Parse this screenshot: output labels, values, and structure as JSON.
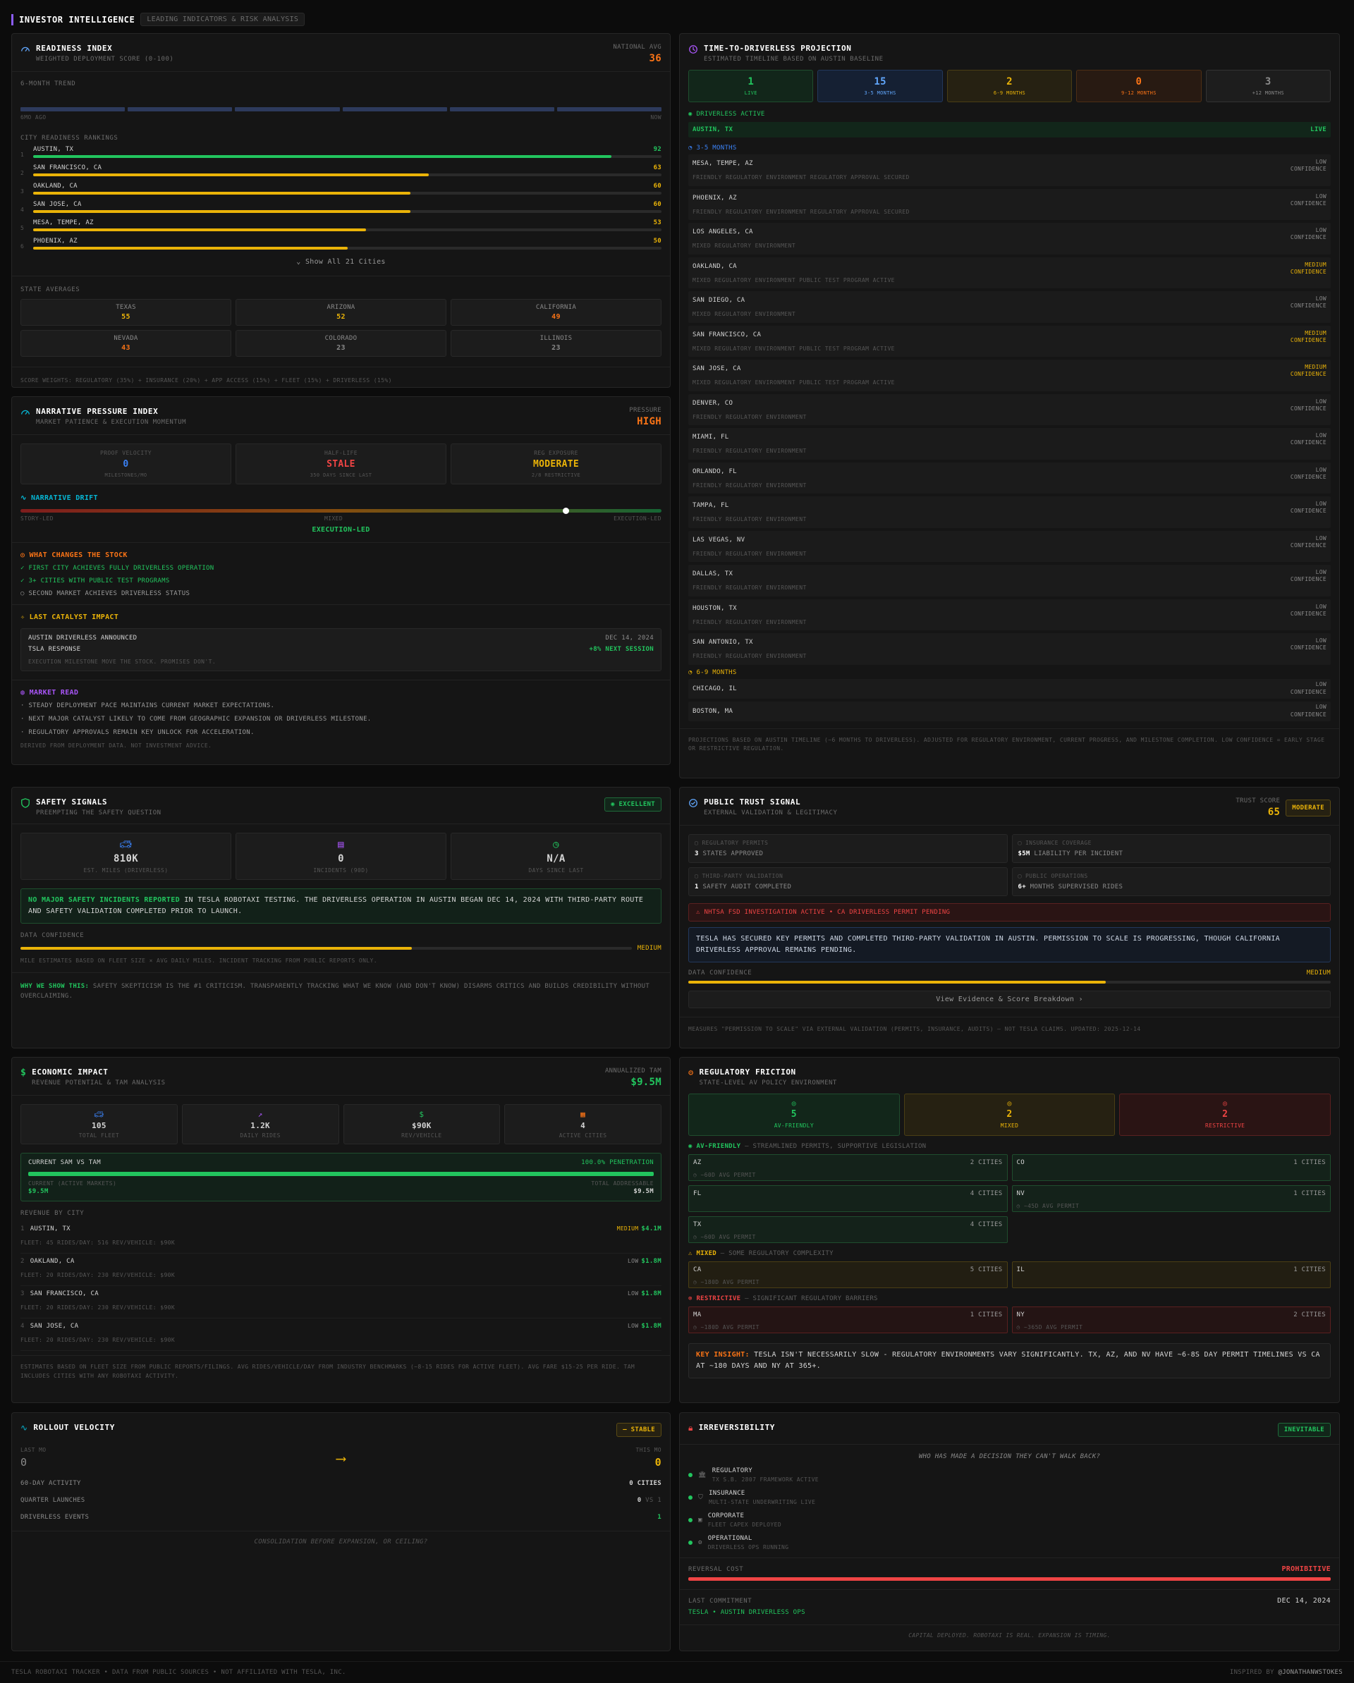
{
  "header": {
    "title": "INVESTOR INTELLIGENCE",
    "tag": "LEADING INDICATORS & RISK ANALYSIS"
  },
  "readiness": {
    "title": "READINESS INDEX",
    "subtitle": "WEIGHTED DEPLOYMENT SCORE (0-100)",
    "avg_label": "NATIONAL AVG",
    "avg_value": "36",
    "trend_label": "6-MONTH TREND",
    "trend_start": "6MO AGO",
    "trend_end": "NOW",
    "rank_label": "CITY READINESS RANKINGS",
    "cities": [
      {
        "rank": "1",
        "name": "AUSTIN, TX",
        "score": "92",
        "pct": 0.92,
        "color": "#22c55e"
      },
      {
        "rank": "2",
        "name": "SAN FRANCISCO, CA",
        "score": "63",
        "pct": 0.63,
        "color": "#eab308"
      },
      {
        "rank": "3",
        "name": "OAKLAND, CA",
        "score": "60",
        "pct": 0.6,
        "color": "#eab308"
      },
      {
        "rank": "4",
        "name": "SAN JOSE, CA",
        "score": "60",
        "pct": 0.6,
        "color": "#eab308"
      },
      {
        "rank": "5",
        "name": "MESA, TEMPE, AZ",
        "score": "53",
        "pct": 0.53,
        "color": "#eab308"
      },
      {
        "rank": "6",
        "name": "PHOENIX, AZ",
        "score": "50",
        "pct": 0.5,
        "color": "#eab308"
      }
    ],
    "show_all": "Show All 21 Cities",
    "state_label": "STATE AVERAGES",
    "states": [
      {
        "name": "TEXAS",
        "value": "55",
        "color": "#eab308"
      },
      {
        "name": "ARIZONA",
        "value": "52",
        "color": "#eab308"
      },
      {
        "name": "CALIFORNIA",
        "value": "49",
        "color": "#f97316"
      },
      {
        "name": "NEVADA",
        "value": "43",
        "color": "#f97316"
      },
      {
        "name": "COLORADO",
        "value": "23",
        "color": "#8a8a8a"
      },
      {
        "name": "ILLINOIS",
        "value": "23",
        "color": "#8a8a8a"
      }
    ],
    "footer": "SCORE WEIGHTS: REGULATORY (35%) + INSURANCE (20%) + APP ACCESS (15%) + FLEET (15%) + DRIVERLESS (15%)"
  },
  "narrative": {
    "title": "NARRATIVE PRESSURE INDEX",
    "subtitle": "MARKET PATIENCE & EXECUTION MOMENTUM",
    "pressure_label": "PRESSURE",
    "pressure_value": "HIGH",
    "metrics": [
      {
        "label": "PROOF VELOCITY",
        "value": "0",
        "sub": "MILESTONES/MO",
        "color": "#3b82f6"
      },
      {
        "label": "HALF-LIFE",
        "value": "STALE",
        "sub": "350 DAYS SINCE LAST",
        "color": "#ef4444"
      },
      {
        "label": "REG EXPOSURE",
        "value": "MODERATE",
        "sub": "2/8 RESTRICTIVE",
        "color": "#eab308"
      }
    ],
    "drift_label": "NARRATIVE DRIFT",
    "drift_left": "STORY-LED",
    "drift_mid": "MIXED",
    "drift_right": "EXECUTION-LED",
    "drift_value": "EXECUTION-LED",
    "drift_pos": 0.85,
    "changes_label": "WHAT CHANGES THE STOCK",
    "changes": [
      {
        "mark": "✓",
        "text": "FIRST CITY ACHIEVES FULLY DRIVERLESS OPERATION",
        "color": "#22c55e"
      },
      {
        "mark": "✓",
        "text": "3+ CITIES WITH PUBLIC TEST PROGRAMS",
        "color": "#22c55e"
      },
      {
        "mark": "○",
        "text": "SECOND MARKET ACHIEVES DRIVERLESS STATUS",
        "color": "#9a9a9a"
      }
    ],
    "catalyst_label": "LAST CATALYST IMPACT",
    "catalyst_event": "AUSTIN DRIVERLESS ANNOUNCED",
    "catalyst_date": "DEC 14, 2024",
    "catalyst_resp_label": "TSLA RESPONSE",
    "catalyst_resp": "+8% NEXT SESSION",
    "catalyst_note": "EXECUTION MILESTONE MOVE THE STOCK. PROMISES DON'T.",
    "read_label": "MARKET READ",
    "reads": [
      "STEADY DEPLOYMENT PACE MAINTAINS CURRENT MARKET EXPECTATIONS.",
      "NEXT MAJOR CATALYST LIKELY TO COME FROM GEOGRAPHIC EXPANSION OR DRIVERLESS MILESTONE.",
      "REGULATORY APPROVALS REMAIN KEY UNLOCK FOR ACCELERATION."
    ],
    "footer": "DERIVED FROM DEPLOYMENT DATA. NOT INVESTMENT ADVICE."
  },
  "projection": {
    "title": "TIME-TO-DRIVERLESS PROJECTION",
    "subtitle": "ESTIMATED TIMELINE BASED ON AUSTIN BASELINE",
    "buckets": [
      {
        "value": "1",
        "label": "LIVE",
        "color": "#22c55e",
        "bg": "#12261a",
        "bd": "#1f4d2e"
      },
      {
        "value": "15",
        "label": "3-5 MONTHS",
        "color": "#60a5fa",
        "bg": "#152033",
        "bd": "#22385c"
      },
      {
        "value": "2",
        "label": "6-9 MONTHS",
        "color": "#eab308",
        "bg": "#262112",
        "bd": "#4a3e14"
      },
      {
        "value": "0",
        "label": "9-12 MONTHS",
        "color": "#f97316",
        "bg": "#281a12",
        "bd": "#4d2e14"
      },
      {
        "value": "3",
        "label": "+12 MONTHS",
        "color": "#8a8a8a",
        "bg": "#1d1d1d",
        "bd": "#333"
      }
    ],
    "live_label": "DRIVERLESS ACTIVE",
    "live_city": "AUSTIN, TX",
    "live_tag": "LIVE",
    "g35_label": "3-5 MONTHS",
    "g35": [
      {
        "city": "MESA, TEMPE, AZ",
        "note": "FRIENDLY REGULATORY ENVIRONMENT REGULATORY APPROVAL SECURED",
        "c1": "LOW",
        "c2": "CONFIDENCE",
        "cc": "#8a8a8a"
      },
      {
        "city": "PHOENIX, AZ",
        "note": "FRIENDLY REGULATORY ENVIRONMENT REGULATORY APPROVAL SECURED",
        "c1": "LOW",
        "c2": "CONFIDENCE",
        "cc": "#8a8a8a"
      },
      {
        "city": "LOS ANGELES, CA",
        "note": "MIXED REGULATORY ENVIRONMENT",
        "c1": "LOW",
        "c2": "CONFIDENCE",
        "cc": "#8a8a8a"
      },
      {
        "city": "OAKLAND, CA",
        "note": "MIXED REGULATORY ENVIRONMENT PUBLIC TEST PROGRAM ACTIVE",
        "c1": "MEDIUM",
        "c2": "CONFIDENCE",
        "cc": "#eab308"
      },
      {
        "city": "SAN DIEGO, CA",
        "note": "MIXED REGULATORY ENVIRONMENT",
        "c1": "LOW",
        "c2": "CONFIDENCE",
        "cc": "#8a8a8a"
      },
      {
        "city": "SAN FRANCISCO, CA",
        "note": "MIXED REGULATORY ENVIRONMENT PUBLIC TEST PROGRAM ACTIVE",
        "c1": "MEDIUM",
        "c2": "CONFIDENCE",
        "cc": "#eab308"
      },
      {
        "city": "SAN JOSE, CA",
        "note": "MIXED REGULATORY ENVIRONMENT PUBLIC TEST PROGRAM ACTIVE",
        "c1": "MEDIUM",
        "c2": "CONFIDENCE",
        "cc": "#eab308"
      },
      {
        "city": "DENVER, CO",
        "note": "FRIENDLY REGULATORY ENVIRONMENT",
        "c1": "LOW",
        "c2": "CONFIDENCE",
        "cc": "#8a8a8a"
      },
      {
        "city": "MIAMI, FL",
        "note": "FRIENDLY REGULATORY ENVIRONMENT",
        "c1": "LOW",
        "c2": "CONFIDENCE",
        "cc": "#8a8a8a"
      },
      {
        "city": "ORLANDO, FL",
        "note": "FRIENDLY REGULATORY ENVIRONMENT",
        "c1": "LOW",
        "c2": "CONFIDENCE",
        "cc": "#8a8a8a"
      },
      {
        "city": "TAMPA, FL",
        "note": "FRIENDLY REGULATORY ENVIRONMENT",
        "c1": "LOW",
        "c2": "CONFIDENCE",
        "cc": "#8a8a8a"
      },
      {
        "city": "LAS VEGAS, NV",
        "note": "FRIENDLY REGULATORY ENVIRONMENT",
        "c1": "LOW",
        "c2": "CONFIDENCE",
        "cc": "#8a8a8a"
      },
      {
        "city": "DALLAS, TX",
        "note": "FRIENDLY REGULATORY ENVIRONMENT",
        "c1": "LOW",
        "c2": "CONFIDENCE",
        "cc": "#8a8a8a"
      },
      {
        "city": "HOUSTON, TX",
        "note": "FRIENDLY REGULATORY ENVIRONMENT",
        "c1": "LOW",
        "c2": "CONFIDENCE",
        "cc": "#8a8a8a"
      },
      {
        "city": "SAN ANTONIO, TX",
        "note": "FRIENDLY REGULATORY ENVIRONMENT",
        "c1": "LOW",
        "c2": "CONFIDENCE",
        "cc": "#8a8a8a"
      }
    ],
    "g69_label": "6-9 MONTHS",
    "g69": [
      {
        "city": "CHICAGO, IL",
        "c1": "LOW",
        "c2": "CONFIDENCE"
      },
      {
        "city": "BOSTON, MA",
        "c1": "LOW",
        "c2": "CONFIDENCE"
      }
    ],
    "footer": "PROJECTIONS BASED ON AUSTIN TIMELINE (~6 MONTHS TO DRIVERLESS). ADJUSTED FOR REGULATORY ENVIRONMENT, CURRENT PROGRESS, AND MILESTONE COMPLETION. LOW CONFIDENCE = EARLY STAGE OR RESTRICTIVE REGULATION."
  },
  "safety": {
    "title": "SAFETY SIGNALS",
    "subtitle": "PREEMPTING THE SAFETY QUESTION",
    "badge": "EXCELLENT",
    "stats": [
      {
        "value": "810K",
        "label": "EST. MILES (DRIVERLESS)",
        "icon": "car-icon",
        "color": "#3b82f6"
      },
      {
        "value": "0",
        "label": "INCIDENTS (90D)",
        "icon": "report-icon",
        "color": "#a855f7"
      },
      {
        "value": "N/A",
        "label": "DAYS SINCE LAST",
        "icon": "clock-icon",
        "color": "#22c55e"
      }
    ],
    "note_hl": "NO MAJOR SAFETY INCIDENTS REPORTED",
    "note": " IN TESLA ROBOTAXI TESTING. THE DRIVERLESS OPERATION IN AUSTIN BEGAN DEC 14, 2024 WITH THIRD-PARTY ROUTE AND SAFETY VALIDATION COMPLETED PRIOR TO LAUNCH.",
    "conf_label": "DATA CONFIDENCE",
    "conf_value": "MEDIUM",
    "conf_pct": 0.64,
    "conf_note": "MILE ESTIMATES BASED ON FLEET SIZE × AVG DAILY MILES. INCIDENT TRACKING FROM PUBLIC REPORTS ONLY.",
    "why_label": "WHY WE SHOW THIS:",
    "why": " SAFETY SKEPTICISM IS THE #1 CRITICISM. TRANSPARENTLY TRACKING WHAT WE KNOW (AND DON'T KNOW) DISARMS CRITICS AND BUILDS CREDIBILITY WITHOUT OVERCLAIMING."
  },
  "trust": {
    "title": "PUBLIC TRUST SIGNAL",
    "subtitle": "EXTERNAL VALIDATION & LEGITIMACY",
    "score_label": "TRUST SCORE",
    "score": "65",
    "badge": "MODERATE",
    "items": [
      {
        "label": "REGULATORY PERMITS",
        "num": "3",
        "text": "STATES APPROVED"
      },
      {
        "label": "INSURANCE COVERAGE",
        "num": "$5M",
        "text": "LIABILITY PER INCIDENT"
      },
      {
        "label": "THIRD-PARTY VALIDATION",
        "num": "1",
        "text": "SAFETY AUDIT COMPLETED"
      },
      {
        "label": "PUBLIC OPERATIONS",
        "num": "6+",
        "text": "MONTHS SUPERVISED RIDES"
      }
    ],
    "alert": "NHTSA FSD INVESTIGATION ACTIVE • CA DRIVERLESS PERMIT PENDING",
    "summary": "TESLA HAS SECURED KEY PERMITS AND COMPLETED THIRD-PARTY VALIDATION IN AUSTIN. PERMISSION TO SCALE IS PROGRESSING, THOUGH CALIFORNIA DRIVERLESS APPROVAL REMAINS PENDING.",
    "conf_label": "DATA CONFIDENCE",
    "conf_value": "MEDIUM",
    "conf_pct": 0.65,
    "button": "View Evidence & Score Breakdown ›",
    "footer": "MEASURES \"PERMISSION TO SCALE\" VIA EXTERNAL VALIDATION (PERMITS, INSURANCE, AUDITS) — NOT TESLA CLAIMS. UPDATED: 2025-12-14"
  },
  "economic": {
    "title": "ECONOMIC IMPACT",
    "subtitle": "REVENUE POTENTIAL & TAM ANALYSIS",
    "tam_label": "ANNUALIZED TAM",
    "tam_value": "$9.5M",
    "stats": [
      {
        "value": "105",
        "label": "TOTAL FLEET",
        "icon": "car-icon",
        "color": "#3b82f6"
      },
      {
        "value": "1.2K",
        "label": "DAILY RIDES",
        "icon": "trend-icon",
        "color": "#a855f7"
      },
      {
        "value": "$90K",
        "label": "REV/VEHICLE",
        "icon": "dollar-icon",
        "color": "#22c55e"
      },
      {
        "value": "4",
        "label": "ACTIVE CITIES",
        "icon": "building-icon",
        "color": "#f97316"
      }
    ],
    "sam_label": "CURRENT SAM VS TAM",
    "sam_pen": "100.0% PENETRATION",
    "sam_l1": "CURRENT (ACTIVE MARKETS)",
    "sam_l2": "$9.5M",
    "sam_r1": "TOTAL ADDRESSABLE",
    "sam_r2": "$9.5M",
    "sam_pct": 1.0,
    "rev_label": "REVENUE BY CITY",
    "revs": [
      {
        "rank": "1",
        "city": "AUSTIN, TX",
        "conf": "MEDIUM",
        "cc": "#eab308",
        "amount": "$4.1M",
        "detail": "FLEET: 45  RIDES/DAY: 516  REV/VEHICLE: $90K"
      },
      {
        "rank": "2",
        "city": "OAKLAND, CA",
        "conf": "LOW",
        "cc": "#8a8a8a",
        "amount": "$1.8M",
        "detail": "FLEET: 20  RIDES/DAY: 230  REV/VEHICLE: $90K"
      },
      {
        "rank": "3",
        "city": "SAN FRANCISCO, CA",
        "conf": "LOW",
        "cc": "#8a8a8a",
        "amount": "$1.8M",
        "detail": "FLEET: 20  RIDES/DAY: 230  REV/VEHICLE: $90K"
      },
      {
        "rank": "4",
        "city": "SAN JOSE, CA",
        "conf": "LOW",
        "cc": "#8a8a8a",
        "amount": "$1.8M",
        "detail": "FLEET: 20  RIDES/DAY: 230  REV/VEHICLE: $90K"
      }
    ],
    "footer": "ESTIMATES BASED ON FLEET SIZE FROM PUBLIC REPORTS/FILINGS. AVG RIDES/VEHICLE/DAY FROM INDUSTRY BENCHMARKS (~8-15 RIDES FOR ACTIVE FLEET). AVG FARE $15-25 PER RIDE. TAM INCLUDES CITIES WITH ANY ROBOTAXI ACTIVITY."
  },
  "regulatory": {
    "title": "REGULATORY FRICTION",
    "subtitle": "STATE-LEVEL AV POLICY ENVIRONMENT",
    "summary": [
      {
        "value": "5",
        "label": "AV-FRIENDLY",
        "color": "#22c55e",
        "bg": "#12261a",
        "bd": "#1f4d2e"
      },
      {
        "value": "2",
        "label": "MIXED",
        "color": "#eab308",
        "bg": "#262112",
        "bd": "#4a3e14"
      },
      {
        "value": "2",
        "label": "RESTRICTIVE",
        "color": "#ef4444",
        "bg": "#2a1414",
        "bd": "#5a2020"
      }
    ],
    "friendly_label": "AV-FRIENDLY",
    "friendly_desc": "— STREAMLINED PERMITS, SUPPORTIVE LEGISLATION",
    "friendly": [
      {
        "st": "AZ",
        "cities": "2 CITIES",
        "note": "~60D AVG PERMIT"
      },
      {
        "st": "CO",
        "cities": "1 CITIES",
        "note": ""
      },
      {
        "st": "FL",
        "cities": "4 CITIES",
        "note": ""
      },
      {
        "st": "NV",
        "cities": "1 CITIES",
        "note": "~45D AVG PERMIT"
      },
      {
        "st": "TX",
        "cities": "4 CITIES",
        "note": "~60D AVG PERMIT"
      }
    ],
    "mixed_label": "MIXED",
    "mixed_desc": "— SOME REGULATORY COMPLEXITY",
    "mixed": [
      {
        "st": "CA",
        "cities": "5 CITIES",
        "note": "~180D AVG PERMIT"
      },
      {
        "st": "IL",
        "cities": "1 CITIES",
        "note": ""
      }
    ],
    "restr_label": "RESTRICTIVE",
    "restr_desc": "— SIGNIFICANT REGULATORY BARRIERS",
    "restr": [
      {
        "st": "MA",
        "cities": "1 CITIES",
        "note": "~180D AVG PERMIT"
      },
      {
        "st": "NY",
        "cities": "2 CITIES",
        "note": "~365D AVG PERMIT"
      }
    ],
    "insight_label": "KEY INSIGHT:",
    "insight": " TESLA ISN'T NECESSARILY SLOW - REGULATORY ENVIRONMENTS VARY SIGNIFICANTLY. TX, AZ, AND NV HAVE ~6-8S DAY PERMIT TIMELINES VS CA AT ~180 DAYS AND NY AT 365+."
  },
  "rollout": {
    "title": "ROLLOUT VELOCITY",
    "badge": "— STABLE",
    "last_label": "LAST MO",
    "last_value": "0",
    "this_label": "THIS MO",
    "this_value": "0",
    "rows": [
      {
        "label": "60-DAY ACTIVITY",
        "value": "0 CITIES"
      },
      {
        "label": "QUARTER LAUNCHES",
        "value": "0",
        "suffix": "VS 1"
      },
      {
        "label": "DRIVERLESS EVENTS",
        "value": "1"
      }
    ],
    "footer": "CONSOLIDATION BEFORE EXPANSION, OR CEILING?"
  },
  "irrev": {
    "title": "IRREVERSIBILITY",
    "badge": "INEVITABLE",
    "question": "WHO HAS MADE A DECISION THEY CAN'T WALK BACK?",
    "items": [
      {
        "label": "REGULATORY",
        "sub": "TX S.B. 2807 FRAMEWORK ACTIVE",
        "icon": "bank-icon"
      },
      {
        "label": "INSURANCE",
        "sub": "MULTI-STATE UNDERWRITING LIVE",
        "icon": "shield-icon"
      },
      {
        "label": "CORPORATE",
        "sub": "FLEET CAPEX DEPLOYED",
        "icon": "briefcase-icon"
      },
      {
        "label": "OPERATIONAL",
        "sub": "DRIVERLESS OPS RUNNING",
        "icon": "gear-icon"
      }
    ],
    "cost_label": "REVERSAL COST",
    "cost_value": "PROHIBITIVE",
    "last_label": "LAST COMMITMENT",
    "last_date": "DEC 14, 2024",
    "last_event": "TESLA • AUSTIN DRIVERLESS OPS",
    "footer": "CAPITAL DEPLOYED. ROBOTAXI IS REAL. EXPANSION IS TIMING."
  },
  "footer": {
    "left": "TESLA ROBOTAXI TRACKER • DATA FROM PUBLIC SOURCES • NOT AFFILIATED WITH TESLA, INC.",
    "right_pre": "INSPIRED BY ",
    "right_handle": "@JONATHANWSTOKES"
  }
}
